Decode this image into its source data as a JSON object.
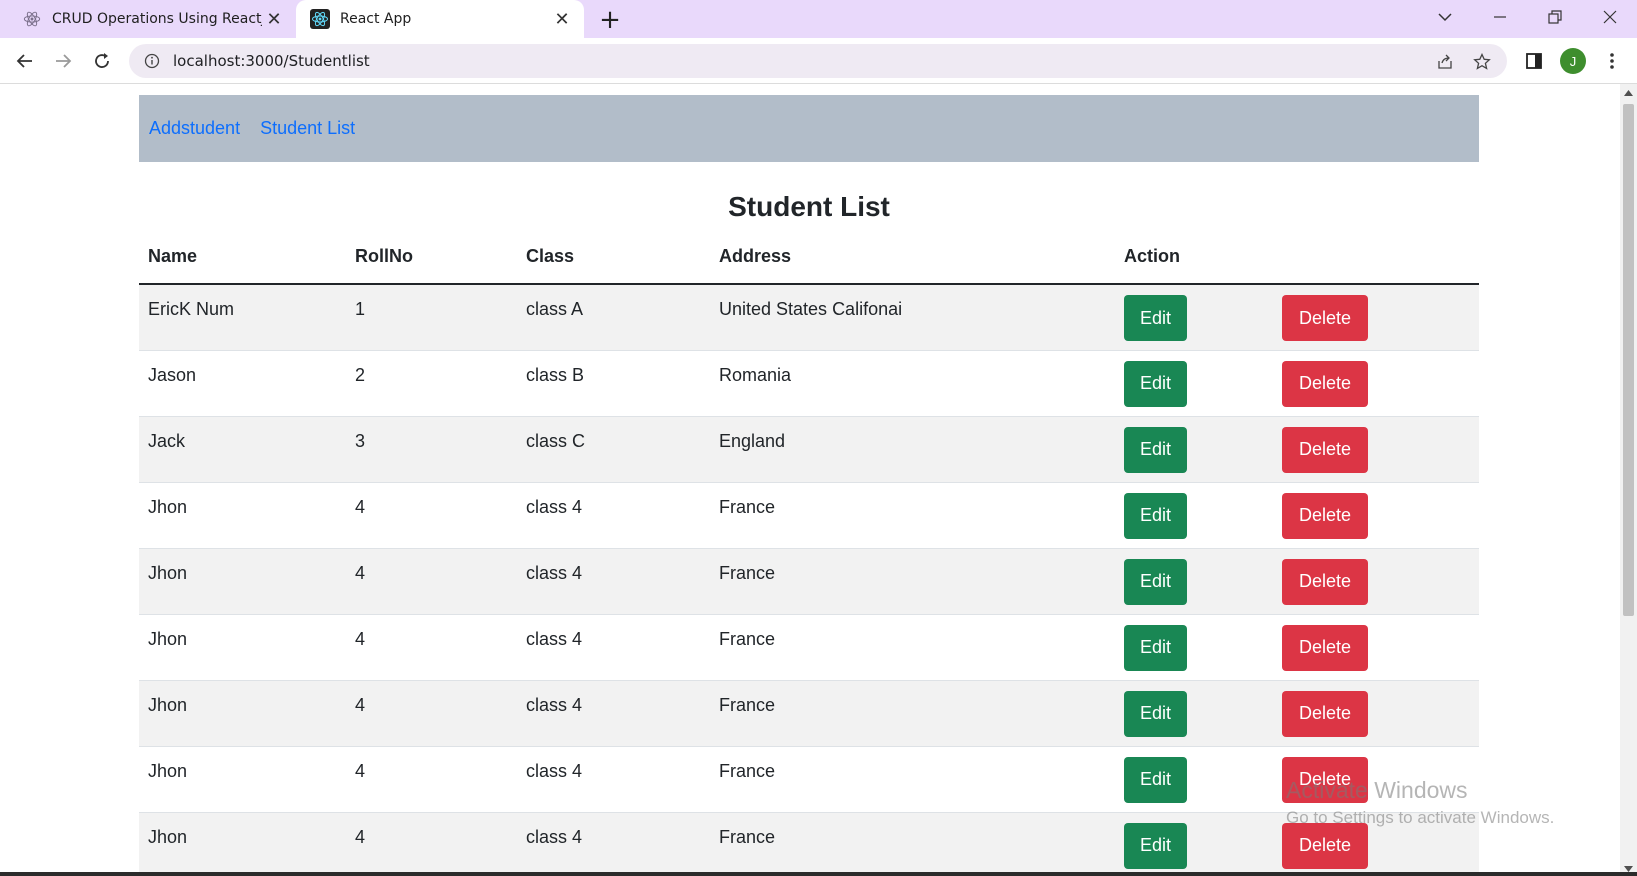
{
  "browser": {
    "tabs": [
      {
        "title": "CRUD Operations Using ReactJS",
        "active": false
      },
      {
        "title": "React App",
        "active": true
      }
    ],
    "url": "localhost:3000/Studentlist",
    "profile_initial": "J"
  },
  "nav": {
    "links": [
      "Addstudent",
      "Student List"
    ]
  },
  "page": {
    "heading": "Student List"
  },
  "table": {
    "headers": [
      "Name",
      "RollNo",
      "Class",
      "Address",
      "Action"
    ],
    "rows": [
      [
        "EricK Num",
        "1",
        "class A",
        "United States Califonai"
      ],
      [
        "Jason",
        "2",
        "class B",
        "Romania"
      ],
      [
        "Jack",
        "3",
        "class C",
        "England"
      ],
      [
        "Jhon",
        "4",
        "class 4",
        "France"
      ],
      [
        "Jhon",
        "4",
        "class 4",
        "France"
      ],
      [
        "Jhon",
        "4",
        "class 4",
        "France"
      ],
      [
        "Jhon",
        "4",
        "class 4",
        "France"
      ],
      [
        "Jhon",
        "4",
        "class 4",
        "France"
      ],
      [
        "Jhon",
        "4",
        "class 4",
        "France"
      ]
    ],
    "edit_label": "Edit",
    "delete_label": "Delete"
  },
  "watermark": {
    "line1": "Activate Windows",
    "line2": "Go to Settings to activate Windows."
  },
  "colors": {
    "tabbar": "#e9d9fb",
    "nav_bg": "#b2bdc9",
    "link": "#0d6efd",
    "edit": "#198754",
    "delete": "#dc3545"
  }
}
